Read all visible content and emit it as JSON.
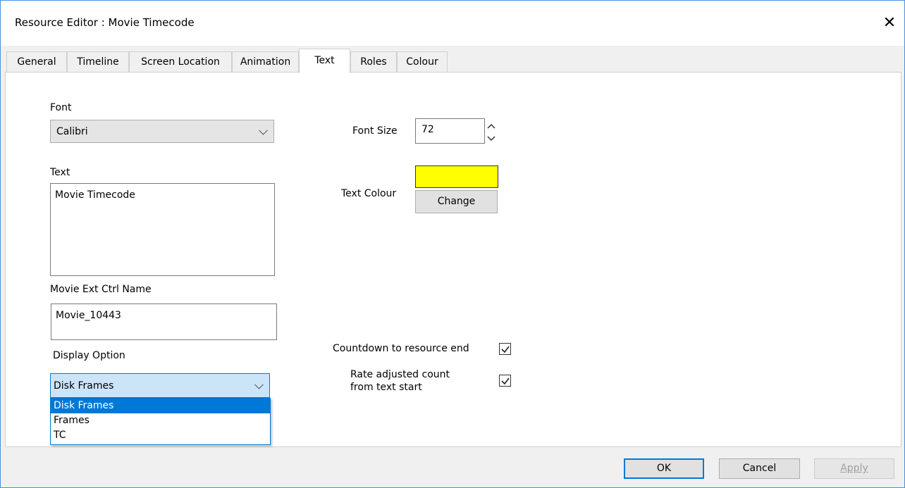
{
  "window": {
    "title": "Resource Editor  :  Movie Timecode",
    "close_glyph": "✕"
  },
  "tabs": [
    {
      "label": "General"
    },
    {
      "label": "Timeline"
    },
    {
      "label": "Screen Location"
    },
    {
      "label": "Animation"
    },
    {
      "label": "Text",
      "active": true
    },
    {
      "label": "Roles"
    },
    {
      "label": "Colour"
    }
  ],
  "font": {
    "label": "Font",
    "value": "Calibri"
  },
  "font_size": {
    "label": "Font Size",
    "value": "72"
  },
  "text": {
    "label": "Text",
    "value": "Movie Timecode"
  },
  "text_colour": {
    "label": "Text Colour",
    "swatch": "#ffff00",
    "change_label": "Change"
  },
  "movie_ctrl": {
    "label": "Movie Ext Ctrl Name",
    "value": "Movie_10443"
  },
  "display_option": {
    "label": "Display Option",
    "value": "Disk Frames",
    "options": [
      "Disk Frames",
      "Frames",
      "TC"
    ]
  },
  "countdown": {
    "label": "Countdown to resource end",
    "checked": true
  },
  "rate_adjusted": {
    "label_line1": "Rate adjusted count",
    "label_line2": "from text start",
    "checked": true
  },
  "buttons": {
    "ok": "OK",
    "cancel": "Cancel",
    "apply": "Apply"
  },
  "colors": {
    "accent": "#0078d7",
    "swatch": "#ffff00"
  }
}
